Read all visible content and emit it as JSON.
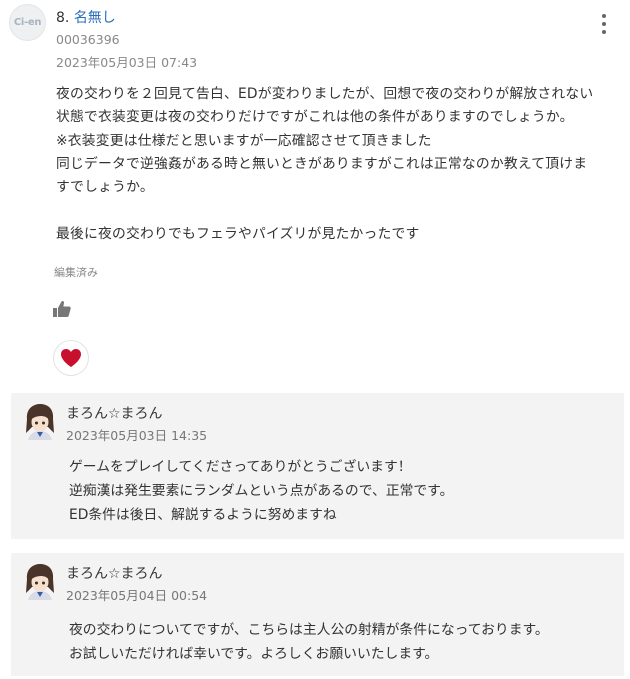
{
  "comment": {
    "avatar_text": "Ci-en",
    "number": "8.",
    "author": "名無し",
    "user_id": "00036396",
    "date": "2023年05月03日 07:43",
    "body_lines": [
      "夜の交わりを２回見て告白、EDが変わりましたが、回想で夜の交わりが解放されない",
      "状態で衣装変更は夜の交わりだけですがこれは他の条件がありますのでしょうか。",
      "※衣装変更は仕様だと思いますが一応確認させて頂きました",
      "同じデータで逆強姦がある時と無いときがありますがこれは正常なのか教えて頂けま",
      "すでしょうか。",
      "",
      "最後に夜の交わりでもフェラやパイズリが見たかったです"
    ],
    "edited_label": "編集済み",
    "icons": {
      "more": "more-vertical-icon",
      "like": "thumbs-up-icon",
      "heart": "heart-icon"
    },
    "heart_color": "#c8102e"
  },
  "replies": [
    {
      "author": "まろん☆まろん",
      "date": "2023年05月03日 14:35",
      "body_lines": [
        "ゲームをプレイしてくださってありがとうございます！",
        "逆痴漢は発生要素にランダムという点があるので、正常です。",
        "ED条件は後日、解説するように努めますね"
      ]
    },
    {
      "author": "まろん☆まろん",
      "date": "2023年05月04日 00:54",
      "body_lines": [
        "夜の交わりについてですが、こちらは主人公の射精が条件になっております。",
        "お試しいただければ幸いです。よろしくお願いいたします。"
      ]
    }
  ]
}
